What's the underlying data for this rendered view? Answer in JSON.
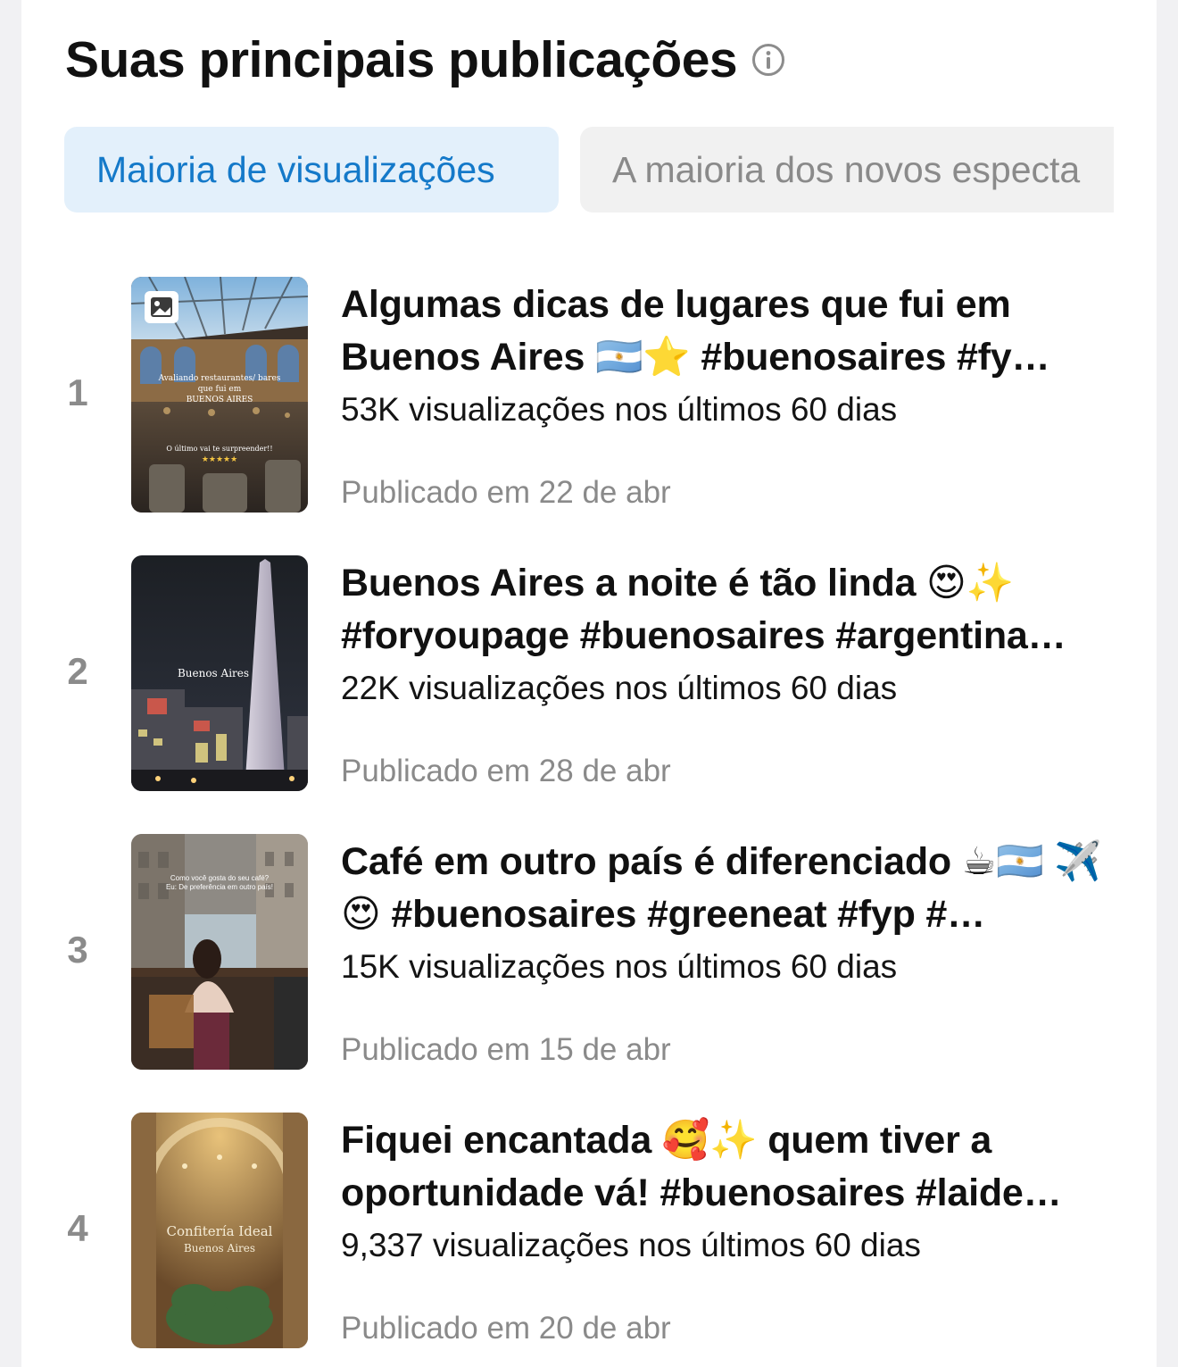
{
  "section": {
    "title": "Suas principais publicações",
    "info_icon": "info-circle-icon"
  },
  "tabs": [
    {
      "label": "Maioria de visualizações",
      "active": true
    },
    {
      "label": "A maioria dos novos especta",
      "active": false
    }
  ],
  "posts": [
    {
      "rank": "1",
      "caption": "Algumas dicas de lugares que fui em Buenos Aires 🇦🇷⭐ #buenosaires #fy…",
      "views": "53K visualizações nos últimos 60 dias",
      "date": "Publicado em 22 de abr",
      "thumb_lines": [
        "Avaliando restaurantes/ bares",
        "que fui em",
        "BUENOS AIRES",
        "O último vai te surpreender!!",
        "★★★★★"
      ],
      "thumb_icon": "carousel-photo-icon"
    },
    {
      "rank": "2",
      "caption": "Buenos Aires a noite é tão linda 😍✨ #foryoupage #buenosaires #argentina…",
      "views": "22K visualizações nos últimos 60 dias",
      "date": "Publicado em 28 de abr",
      "thumb_lines": [
        "Buenos Aires"
      ]
    },
    {
      "rank": "3",
      "caption": "Café em outro país é diferenciado ☕🇦🇷 ✈️😍 #buenosaires #greeneat #fyp #…",
      "views": "15K visualizações nos últimos 60 dias",
      "date": "Publicado em 15 de abr",
      "thumb_lines": [
        "Como você gosta do seu café?",
        "Eu: De preferência em outro país!"
      ]
    },
    {
      "rank": "4",
      "caption": "Fiquei encantada 🥰✨ quem tiver a oportunidade vá!  #buenosaires #laide…",
      "views": "9,337 visualizações nos últimos 60 dias",
      "date": "Publicado em 20 de abr",
      "thumb_lines": [
        "Confitería Ideal",
        "Buenos Aires"
      ]
    }
  ],
  "colors": {
    "active_tab_bg": "#e3f0fb",
    "active_tab_text": "#1479c9",
    "inactive_tab_bg": "#f1f1f1",
    "inactive_tab_text": "#8a8a8a",
    "muted_text": "#8a8a8a"
  }
}
